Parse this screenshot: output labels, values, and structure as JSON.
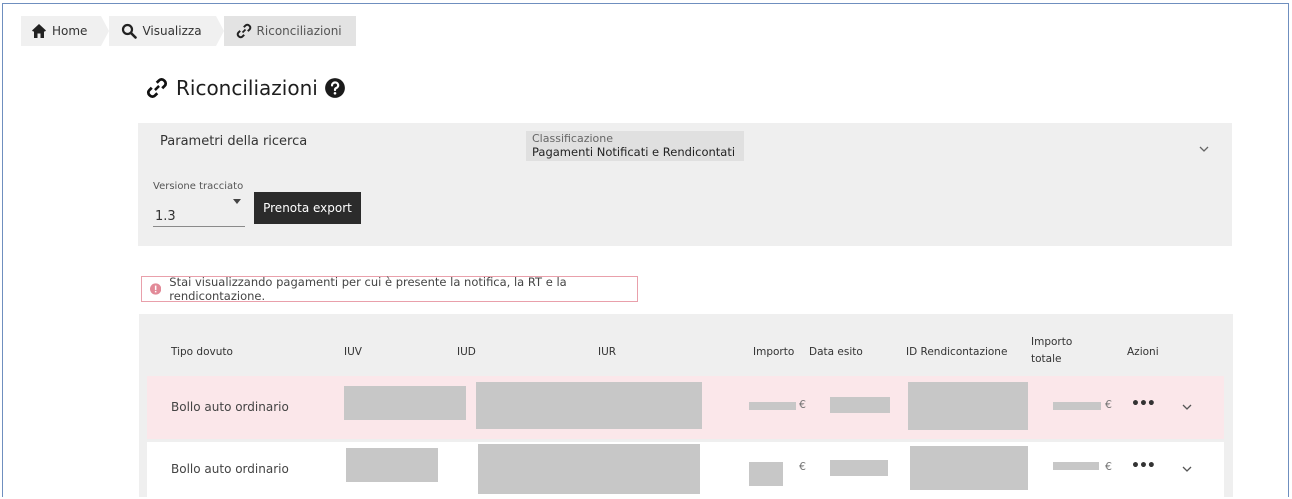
{
  "breadcrumb": {
    "items": [
      {
        "label": "Home",
        "icon": "home-icon"
      },
      {
        "label": "Visualizza",
        "icon": "search-icon"
      },
      {
        "label": "Riconciliazioni",
        "icon": "link-icon"
      }
    ]
  },
  "page": {
    "title": "Riconciliazioni",
    "title_icon": "link-icon",
    "help_icon": "question-circle-icon"
  },
  "search": {
    "label": "Parametri della ricerca",
    "classification_label": "Classificazione",
    "classification_value": "Pagamenti Notificati e Rendicontati",
    "version_label": "Versione tracciato",
    "version_value": "1.3",
    "export_button": "Prenota export"
  },
  "alert": {
    "text": "Stai visualizzando pagamenti per cui è presente la notifica, la RT e la rendicontazione.",
    "icon": "info-circle-icon",
    "color": "#e28a98"
  },
  "table": {
    "columns": [
      "Tipo dovuto",
      "IUV",
      "IUD",
      "IUR",
      "Importo",
      "Data esito",
      "ID Rendicontazione",
      "Importo totale",
      "Azioni"
    ],
    "rows": [
      {
        "tipo_dovuto": "Bollo auto ordinario",
        "importo_currency": "€",
        "importo_totale_currency": "€",
        "actions": "•••"
      },
      {
        "tipo_dovuto": "Bollo auto ordinario",
        "importo_currency": "€",
        "importo_totale_currency": "€",
        "actions": "•••"
      }
    ]
  },
  "colors": {
    "highlight_row": "#fbe7ea",
    "panel_bg": "#efefef",
    "button_bg": "#2b2b2b"
  }
}
